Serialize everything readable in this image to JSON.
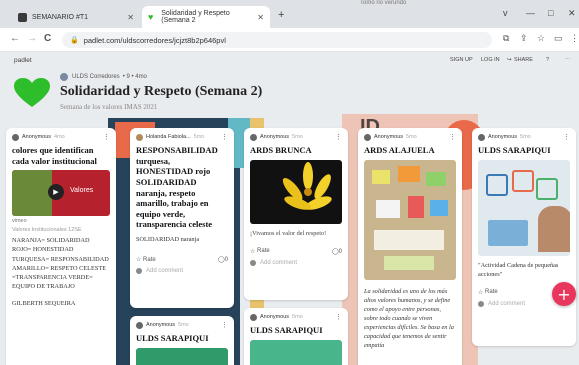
{
  "browser": {
    "tabs": [
      {
        "label": "SEMANARIO #T1",
        "active": false
      },
      {
        "label": "Solidaridad y Respeto (Semana 2",
        "active": true
      }
    ],
    "new_tab": "+",
    "window_controls": [
      "v",
      "—",
      "□",
      "✕"
    ],
    "top_note": "Tomo rio verundo",
    "url": "padlet.com/uldscorredores/jcjzt8b2p646pvl",
    "nav": {
      "back": "←",
      "forward": "→",
      "reload": "C"
    }
  },
  "padlet": {
    "brand": "padlet",
    "actions": {
      "signup": "SIGN UP",
      "login": "LOG IN",
      "share": "SHARE",
      "help": "?",
      "more": "⋯"
    },
    "author": "ULDS Corredores",
    "meta_extra": "• 9 • 4mo",
    "title": "Solidaridad y Respeto (Semana 2)",
    "subtitle": "Semana de los valores IMAS 2021",
    "accent_color": "#e8365d",
    "heart_color": "#2ebd2b"
  },
  "cards": [
    {
      "author": "Anonymous",
      "time": "4mo",
      "title": "colores que identifican cada valor institucional",
      "video_label": "Valores",
      "video_tag": "vimeo",
      "caption": "Valores Institucionales 12SE",
      "body": "NARANJA= SOLIDARIDAD ROJO= HONESTIDAD TURQUESA= RESPONSABILIDAD AMARILLO= RESPETO CELESTE =TRANSPARENCIA VERDE= EQUIPO DE TRABAJO",
      "body2": "GILBERTH SEQUEIRA"
    },
    {
      "author": "Holanda Fabiola...",
      "time": "5mo",
      "title": "RESPONSABILIDAD turquesa, HONESTIDAD rojo SOLIDARIDAD naranja, respeto amarillo, trabajo en equipo verde, transparencia celeste",
      "body": "SOLIDARIDAD naranja",
      "rate": "Rate",
      "comments": "0",
      "add_comment": "Add comment"
    },
    {
      "author": "Anonymous",
      "time": "5mo",
      "title": "ULDS SARAPIQUI"
    },
    {
      "author": "Anonymous",
      "time": "5mo",
      "title": "ARDS BRUNCA",
      "body": "¡Vivamos el valor del respeto!",
      "rate": "Rate",
      "comments": "0",
      "add_comment": "Add comment"
    },
    {
      "author": "Anonymous",
      "time": "5mo",
      "title": "ULDS SARAPIQUI"
    },
    {
      "author": "Anonymous",
      "time": "5mo",
      "title": "ARDS ALAJUELA",
      "body": "La solidaridad es uno de los más altos valores humanos, y se define como el apoyo entre personas, sobre todo cuando se viven experiencias difíciles. Se basa en la capacidad que tenemos de sentir empatía"
    },
    {
      "author": "Anonymous",
      "time": "5mo",
      "title": "ULDS SARAPIQUI",
      "body": "\"Actividad Cadena de pequeñas acciones\"",
      "rate": "Rate",
      "comments": "0",
      "add_comment": "Add comment"
    }
  ],
  "fab_label": "+"
}
